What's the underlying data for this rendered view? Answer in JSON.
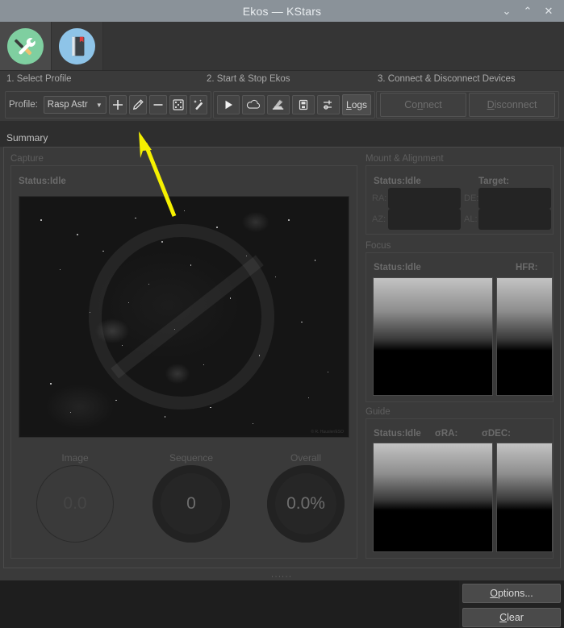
{
  "window": {
    "title": "Ekos — KStars",
    "buttons": [
      {
        "name": "minimize",
        "glyph": "⌄"
      },
      {
        "name": "maximize",
        "glyph": "⌃"
      },
      {
        "name": "close",
        "glyph": "✕"
      }
    ]
  },
  "tabs": [
    {
      "name": "setup-tab",
      "icon": "tools-icon",
      "active": true
    },
    {
      "name": "logs-tab",
      "icon": "notebook-icon",
      "active": false
    }
  ],
  "steps": {
    "one": "1. Select Profile",
    "two": "2. Start & Stop Ekos",
    "three": "3. Connect & Disconnect Devices"
  },
  "profile": {
    "label": "Profile:",
    "selected": "Rasp Astr",
    "buttons": [
      {
        "name": "add-profile-button",
        "icon": "plus-icon"
      },
      {
        "name": "edit-profile-button",
        "icon": "pencil-icon"
      },
      {
        "name": "remove-profile-button",
        "icon": "minus-icon"
      },
      {
        "name": "custom-drivers-button",
        "icon": "dice-icon"
      },
      {
        "name": "profile-wizard-button",
        "icon": "magic-wand-icon"
      }
    ]
  },
  "ekos_controls": [
    {
      "name": "start-ekos-button",
      "icon": "play-icon"
    },
    {
      "name": "cloud-button",
      "icon": "cloud-icon"
    },
    {
      "name": "observatory-button",
      "icon": "observatory-icon"
    },
    {
      "name": "usb-button",
      "icon": "usb-drive-icon"
    },
    {
      "name": "options-sliders-button",
      "icon": "sliders-icon"
    }
  ],
  "logs_button": {
    "prefix": "",
    "accel": "L",
    "suffix": "ogs"
  },
  "devices": {
    "connect": {
      "prefix": "Co",
      "accel": "n",
      "suffix": "nect",
      "enabled": false
    },
    "disconnect": {
      "prefix": "",
      "accel": "D",
      "suffix": "isconnect",
      "enabled": false
    }
  },
  "summary": {
    "label": "Summary",
    "capture": {
      "title": "Capture",
      "status": "Status:Idle",
      "preview_watermark": "© R. Hausler/ESO"
    },
    "gauges": [
      {
        "name": "image-gauge",
        "title": "Image",
        "value": "0.0",
        "style": "hollow"
      },
      {
        "name": "sequence-gauge",
        "title": "Sequence",
        "value": "0",
        "style": "filled"
      },
      {
        "name": "overall-gauge",
        "title": "Overall",
        "value": "0.0%",
        "style": "filled"
      }
    ],
    "mount": {
      "title": "Mount & Alignment",
      "status": "Status:Idle",
      "target_label": "Target:",
      "ra_label": "RA:",
      "de_label": "DE:",
      "az_label": "AZ:",
      "al_label": "AL:",
      "ra_value": "",
      "de_value": "",
      "az_value": "",
      "al_value": ""
    },
    "focus": {
      "title": "Focus",
      "status": "Status:Idle",
      "hfr_label": "HFR:"
    },
    "guide": {
      "title": "Guide",
      "status": "Status:Idle",
      "dra_label": "σRA:",
      "ddec_label": "σDEC:"
    }
  },
  "footer": {
    "options_button": {
      "prefix": "",
      "accel": "O",
      "suffix": "ptions..."
    },
    "clear_button": {
      "prefix": "",
      "accel": "C",
      "suffix": "lear"
    }
  },
  "colors": {
    "titlebar": "#8a9299",
    "window_bg": "#3a3a3a",
    "accent_annotation": "#f5f000",
    "tab_tools_circle": "#7fcfa0",
    "tab_book_circle": "#8ec4e8"
  }
}
